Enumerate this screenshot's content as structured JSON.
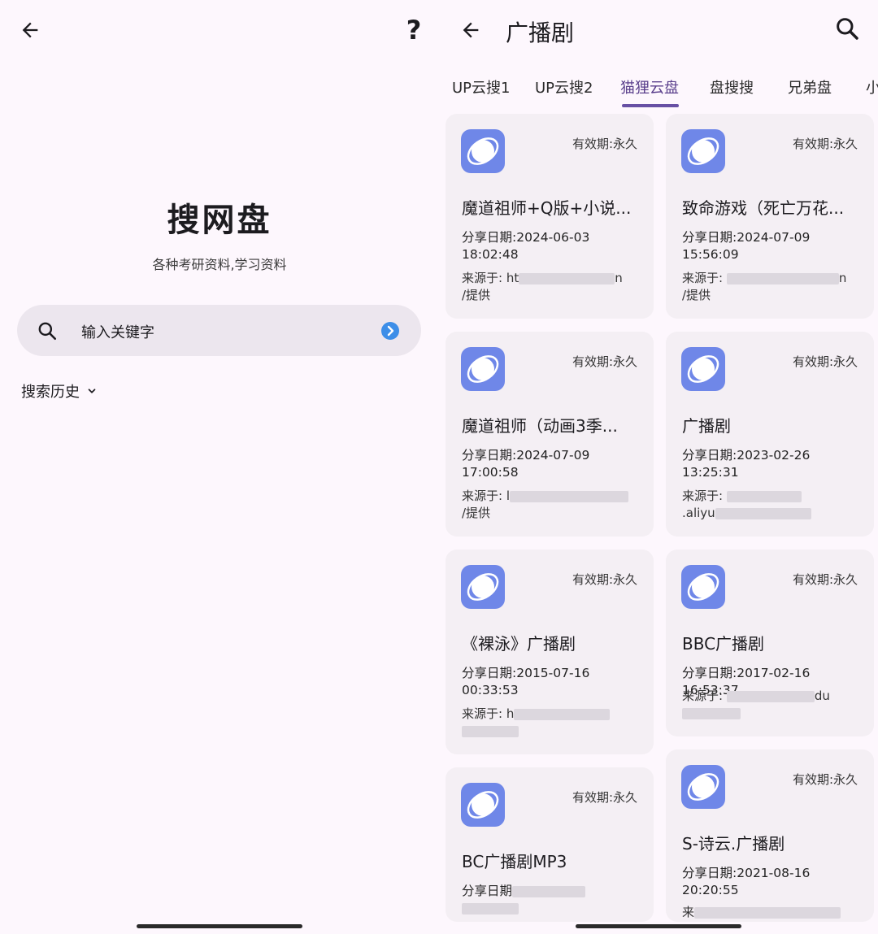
{
  "left": {
    "help_glyph": "?",
    "app_title": "搜网盘",
    "app_subtitle": "各种考研资料,学习资料",
    "search_placeholder": "输入关键字",
    "history_label": "搜索历史"
  },
  "right": {
    "title": "广播剧",
    "tabs": [
      "UP云搜1",
      "UP云搜2",
      "猫狸云盘",
      "盘搜搜",
      "兄弟盘",
      "小"
    ],
    "active_tab": 2,
    "cards": [
      {
        "validity": "有效期:永久",
        "title": "魔道祖师+Q版+小说...",
        "date_line1": "分享日期:2024-06-03",
        "date_line2": "18:02:48",
        "src_prefix": "来源于: ht",
        "src_suffix": "n",
        "provide": "/提供"
      },
      {
        "validity": "有效期:永久",
        "title": "致命游戏（死亡万花...",
        "date_line1": "分享日期:2024-07-09",
        "date_line2": "15:56:09",
        "src_prefix": "来源于: ",
        "src_suffix": "n",
        "provide": "/提供"
      },
      {
        "validity": "有效期:永久",
        "title": "魔道祖师（动画3季...",
        "date_line1": "分享日期:2024-07-09",
        "date_line2": "17:00:58",
        "src_prefix": "来源于: l",
        "src_suffix": "",
        "provide": "/提供"
      },
      {
        "validity": "有效期:永久",
        "title": "广播剧",
        "date_line1": "分享日期:2023-02-26",
        "date_line2": "13:25:31",
        "src_prefix": "来源于: ",
        "src_suffix": "",
        "provide": ".aliyu"
      },
      {
        "validity": "有效期:永久",
        "title": "《裸泳》广播剧",
        "date_line1": "分享日期:2015-07-16",
        "date_line2": "00:33:53",
        "src_prefix": "来源于: h",
        "src_suffix": "",
        "provide": ""
      },
      {
        "validity": "有效期:永久",
        "title": "BBC广播剧",
        "date_line1": "分享日期:2017-02-16 16:53:37",
        "date_line2": "",
        "src_prefix": "来源于: ",
        "src_suffix": "du",
        "provide": ""
      },
      {
        "validity": "有效期:永久",
        "title": "BC广播剧MP3",
        "date_line1": "分享日期",
        "date_line2": "",
        "src_prefix": "",
        "src_suffix": "",
        "provide": ""
      },
      {
        "validity": "有效期:永久",
        "title": "S-诗云.广播剧",
        "date_line1": "分享日期:2021-08-16",
        "date_line2": "20:20:55",
        "src_prefix": "来",
        "src_suffix": "",
        "provide": ""
      }
    ]
  }
}
